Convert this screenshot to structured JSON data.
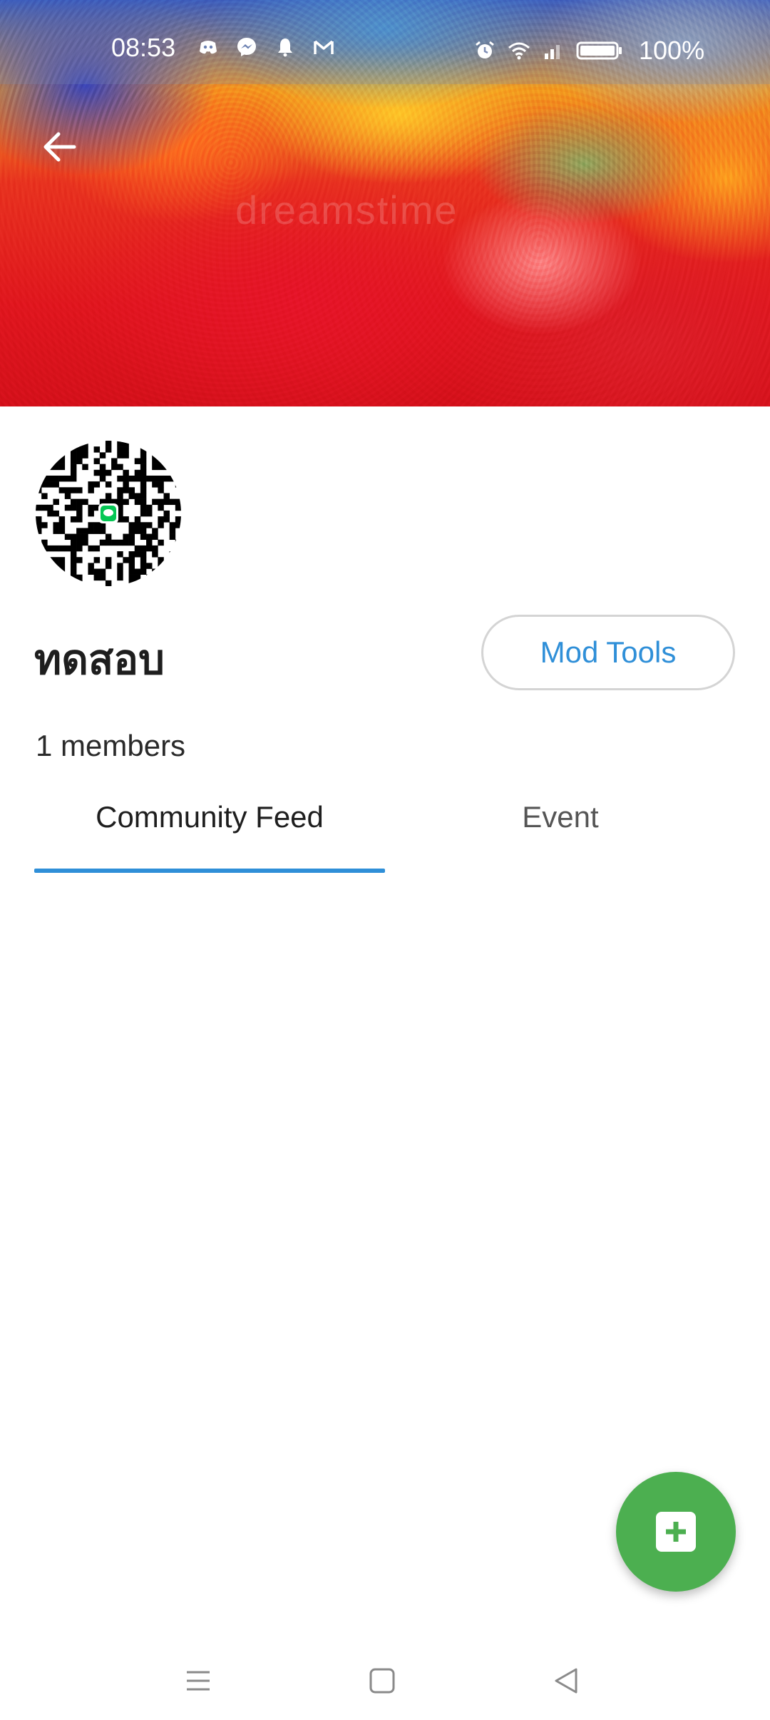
{
  "status_bar": {
    "time": "08:53",
    "battery_text": "100%",
    "left_icons": [
      "discord-icon",
      "messenger-icon",
      "notification-bell-icon",
      "gmail-icon"
    ],
    "right_icons": [
      "alarm-icon",
      "wifi-icon",
      "signal-icon",
      "battery-icon"
    ]
  },
  "header": {
    "cover_watermark": "dreamstime",
    "back_icon": "arrow-left-icon"
  },
  "community": {
    "name": "ทดสอบ",
    "members": "1 members",
    "mod_tools_label": "Mod Tools",
    "avatar_icon": "qr-code-icon"
  },
  "tabs": [
    {
      "label": "Community Feed",
      "active": true
    },
    {
      "label": "Event",
      "active": false
    }
  ],
  "fab": {
    "icon": "plus-box-icon"
  },
  "colors": {
    "accent": "#2f8fd8",
    "fab": "#4caf50",
    "text_primary": "#1e1e1e",
    "text_secondary": "#555555"
  },
  "nav_bar": {
    "icons": [
      "menu-icon",
      "home-square-icon",
      "back-triangle-icon"
    ]
  }
}
